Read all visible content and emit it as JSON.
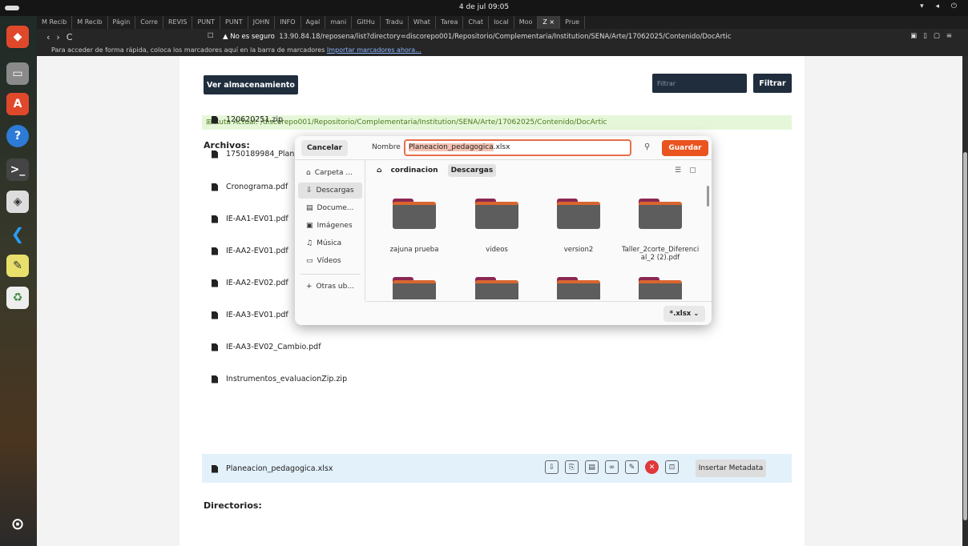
{
  "system": {
    "clock": "4 de jul  09:05"
  },
  "tabs": [
    "M Recib",
    "M Recib",
    "Págin",
    "Corre",
    "REVIS",
    "PUNT",
    "PUNT",
    "JOHN",
    "INFO",
    "Agal",
    "mani",
    "GitHu",
    "Tradu",
    "What",
    "Tarea",
    "Chat",
    "local",
    "Moo",
    "Z ×",
    "Prue"
  ],
  "urlbar": {
    "warning": "▲ No es seguro",
    "url": "13.90.84.18/reposena/list?directory=discorepo001/Repositorio/Complementaria/Institution/SENA/Arte/17062025/Contenido/DocArtic"
  },
  "bookmarks": {
    "text": "Para acceder de forma rápida, coloca los marcadores aquí en la barra de marcadores",
    "link": "Importar marcadores ahora..."
  },
  "page": {
    "storage_button": "Ver almacenamiento",
    "filter_placeholder": "Filtrar",
    "filter_button": "Filtrar",
    "ruta": "Ruta Actual: /discorepo001/Repositorio/Complementaria/Institution/SENA/Arte/17062025/Contenido/DocArtic",
    "files_heading": "Archivos:",
    "files": [
      "120620251.zip",
      "1750189984_Plan",
      "Cronograma.pdf",
      "IE-AA1-EV01.pdf",
      "IE-AA2-EV01.pdf",
      "IE-AA2-EV02.pdf",
      "IE-AA3-EV01.pdf",
      "IE-AA3-EV02_Cambio.pdf",
      "Instrumentos_evaluacionZip.zip",
      "Planeacion_pedagogica.xlsx"
    ],
    "metadata_button": "Insertar Metadata",
    "dirs_heading": "Directorios:"
  },
  "dialog": {
    "cancel": "Cancelar",
    "name_label": "Nombre",
    "filename_base": "Planeacion_pedagogica",
    "filename_ext": ".xlsx",
    "save": "Guardar",
    "sidebar": [
      "Carpeta ...",
      "Descargas",
      "Docume...",
      "Imágenes",
      "Música",
      "Vídeos",
      "Otras ub..."
    ],
    "breadcrumb": [
      "cordinacion",
      "Descargas"
    ],
    "folders": [
      "zajuna prueba",
      "videos",
      "version2",
      "Taller_2corte_Diferencial_2 (2).pdf"
    ],
    "filter": "*.xlsx"
  }
}
